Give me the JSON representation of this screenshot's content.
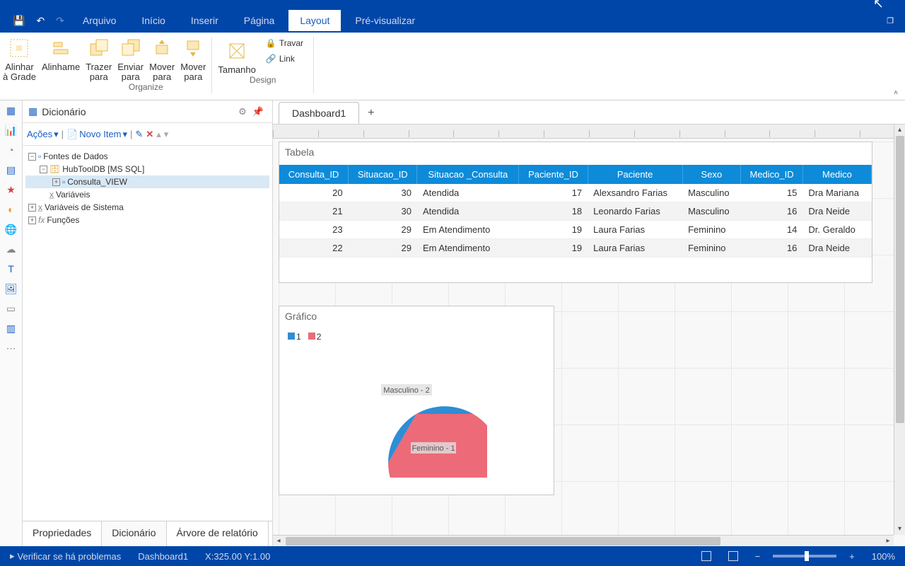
{
  "menu": {
    "arquivo": "Arquivo",
    "inicio": "Início",
    "inserir": "Inserir",
    "pagina": "Página",
    "layout": "Layout",
    "pre": "Pré-visualizar"
  },
  "ribbon": {
    "alinhar_grade": "Alinhar\nà Grade",
    "alinhamento": "Alinhame",
    "trazer_para": "Trazer\npara",
    "enviar_para": "Enviar\npara",
    "mover_para1": "Mover\npara",
    "mover_para2": "Mover\npara",
    "tamanho": "Tamanho",
    "travar": "Travar",
    "link": "Link",
    "organize": "Organize",
    "design": "Design"
  },
  "left_panel": {
    "title": "Dicionário",
    "acoes": "Ações",
    "novo_item": "Novo Item",
    "tree": {
      "fontes": "Fontes de Dados",
      "hubtool": "HubToolDB [MS SQL]",
      "consulta_view": "Consulta_VIEW",
      "variaveis": "Variáveis",
      "var_sistema": "Variáveis de Sistema",
      "funcoes": "Funções"
    },
    "tabs": {
      "propriedades": "Propriedades",
      "dicionario": "Dicionário",
      "arvore": "Árvore de relatório"
    }
  },
  "doc": {
    "tab1": "Dashboard1"
  },
  "table": {
    "title": "Tabela",
    "headers": [
      "Consulta_ID",
      "Situacao_ID",
      "Situacao _Consulta",
      "Paciente_ID",
      "Paciente",
      "Sexo",
      "Medico_ID",
      "Medico"
    ],
    "rows": [
      {
        "c0": "20",
        "c1": "30",
        "c2": "Atendida",
        "c3": "17",
        "c4": "Alexsandro Farias",
        "c5": "Masculino",
        "c6": "15",
        "c7": "Dra Mariana"
      },
      {
        "c0": "21",
        "c1": "30",
        "c2": "Atendida",
        "c3": "18",
        "c4": "Leonardo Farias",
        "c5": "Masculino",
        "c6": "16",
        "c7": "Dra Neide"
      },
      {
        "c0": "23",
        "c1": "29",
        "c2": "Em Atendimento",
        "c3": "19",
        "c4": "Laura Farias",
        "c5": "Feminino",
        "c6": "14",
        "c7": "Dr. Geraldo"
      },
      {
        "c0": "22",
        "c1": "29",
        "c2": "Em Atendimento",
        "c3": "19",
        "c4": "Laura Farias",
        "c5": "Feminino",
        "c6": "16",
        "c7": "Dra Neide"
      }
    ]
  },
  "chart": {
    "title": "Gráfico",
    "legend1": "1",
    "legend2": "2",
    "label1": "Masculino - 2",
    "label2": "Feminino - 1"
  },
  "chart_data": {
    "type": "pie",
    "title": "Gráfico",
    "series": [
      {
        "name": "1",
        "category": "Feminino",
        "value": 1,
        "color": "#2f8dd5"
      },
      {
        "name": "2",
        "category": "Masculino",
        "value": 2,
        "color": "#ed6a78"
      }
    ]
  },
  "status": {
    "verify": "Verificar se há problemas",
    "doc": "Dashboard1",
    "coords": "X:325.00 Y:1.00",
    "zoom": "100%"
  }
}
